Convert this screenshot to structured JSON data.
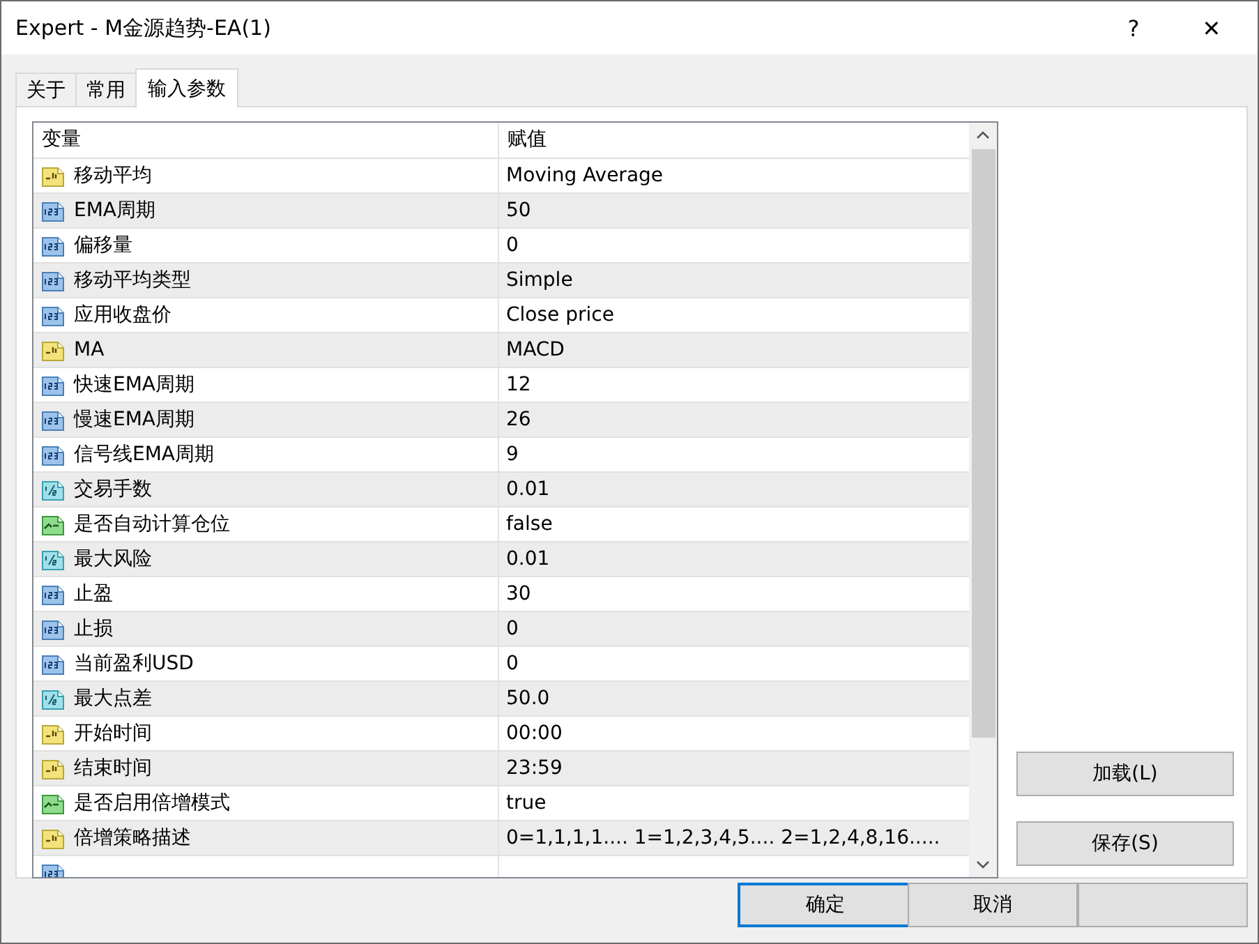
{
  "window": {
    "title": "Expert - M金源趋势-EA(1)",
    "help": "?",
    "close": "✕"
  },
  "tabs": [
    {
      "label": "关于",
      "selected": false
    },
    {
      "label": "常用",
      "selected": false
    },
    {
      "label": "输入参数",
      "selected": true
    }
  ],
  "table": {
    "columns": [
      "变量",
      "赋值"
    ],
    "rows": [
      {
        "kind": "string",
        "name": "移动平均",
        "value": "Moving Average"
      },
      {
        "kind": "int",
        "name": "EMA周期",
        "value": "50"
      },
      {
        "kind": "int",
        "name": "偏移量",
        "value": "0"
      },
      {
        "kind": "int",
        "name": "移动平均类型",
        "value": "Simple"
      },
      {
        "kind": "int",
        "name": "应用收盘价",
        "value": "Close price"
      },
      {
        "kind": "string",
        "name": "MA",
        "value": "MACD"
      },
      {
        "kind": "int",
        "name": "快速EMA周期",
        "value": "12"
      },
      {
        "kind": "int",
        "name": "慢速EMA周期",
        "value": "26"
      },
      {
        "kind": "int",
        "name": "信号线EMA周期",
        "value": "9"
      },
      {
        "kind": "double",
        "name": "交易手数",
        "value": "0.01"
      },
      {
        "kind": "bool",
        "name": "是否自动计算仓位",
        "value": "false"
      },
      {
        "kind": "double",
        "name": "最大风险",
        "value": "0.01"
      },
      {
        "kind": "int",
        "name": "止盈",
        "value": "30"
      },
      {
        "kind": "int",
        "name": "止损",
        "value": "0"
      },
      {
        "kind": "int",
        "name": "当前盈利USD",
        "value": "0"
      },
      {
        "kind": "double",
        "name": "最大点差",
        "value": "50.0"
      },
      {
        "kind": "string",
        "name": "开始时间",
        "value": "00:00"
      },
      {
        "kind": "string",
        "name": "结束时间",
        "value": "23:59"
      },
      {
        "kind": "bool",
        "name": "是否启用倍增模式",
        "value": "true"
      },
      {
        "kind": "string",
        "name": "倍增策略描述",
        "value": "0=1,1,1,1....    1=1,2,3,4,5....    2=1,2,4,8,16....."
      },
      {
        "kind": "int"
      }
    ]
  },
  "side_buttons": [
    "加载(L)",
    "保存(S)"
  ],
  "footer_buttons": [
    {
      "label": "确定",
      "default": true
    },
    {
      "label": "取消",
      "default": false
    },
    {
      "default": false
    }
  ]
}
